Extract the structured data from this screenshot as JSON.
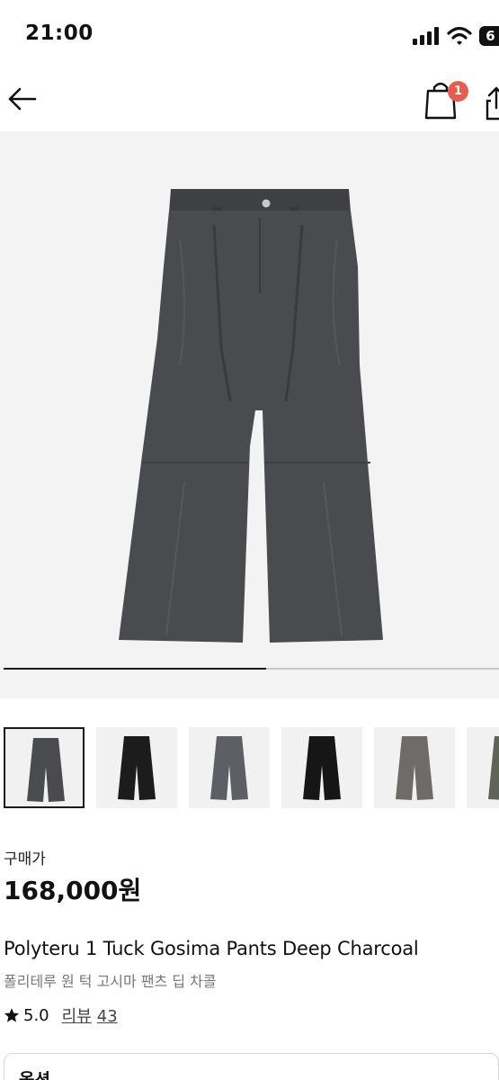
{
  "status_bar": {
    "time": "21:00",
    "battery": "6"
  },
  "nav": {
    "cart_count": "1"
  },
  "gallery": {
    "progress": 0.53,
    "thumbnails": [
      {
        "color": "#4a4b4e",
        "selected": true
      },
      {
        "color": "#1c1c1d",
        "selected": false
      },
      {
        "color": "#5c5f64",
        "selected": false
      },
      {
        "color": "#161616",
        "selected": false
      },
      {
        "color": "#6e6c68",
        "selected": false
      },
      {
        "color": "#5f6459",
        "selected": false
      }
    ]
  },
  "product": {
    "price_label": "구매가",
    "price": "168,000원",
    "name_en": "Polyteru 1 Tuck Gosima Pants Deep Charcoal",
    "name_ko": "폴리테루 원 턱 고시마 팬츠 딥 차콜",
    "rating": "5.0",
    "review_label": "리뷰",
    "review_count": "43"
  },
  "option": {
    "label": "옵션"
  },
  "colors": {
    "pants": "#4a4b4e",
    "badge": "#e85b4d",
    "hero_bg": "#f3f3f3"
  }
}
